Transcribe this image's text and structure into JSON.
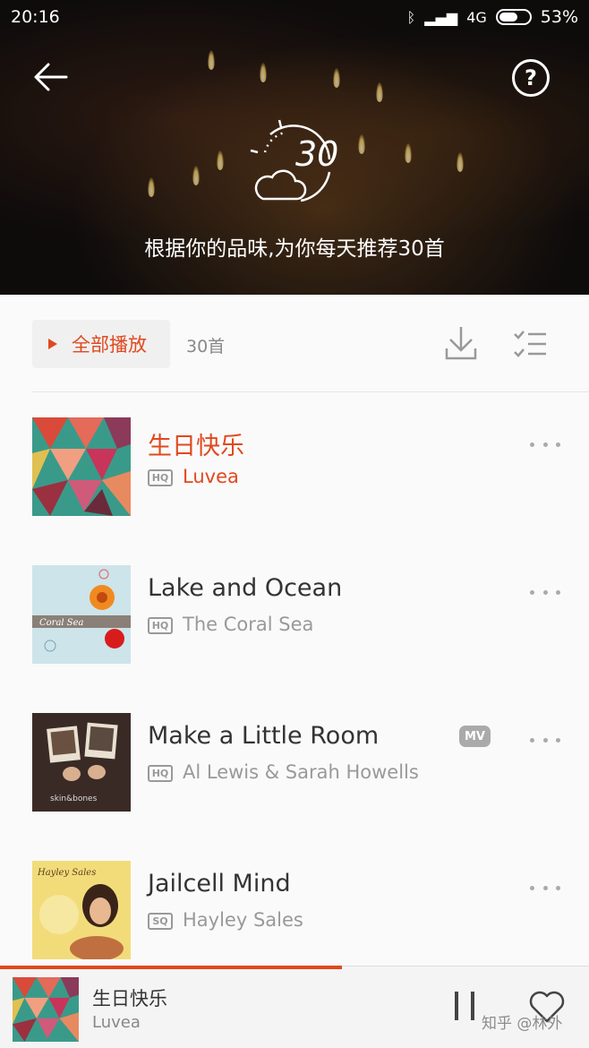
{
  "status_bar": {
    "time": "20:16",
    "network": "4G",
    "battery": "53%"
  },
  "header": {
    "badge_number": "30",
    "caption": "根据你的品味,为你每天推荐30首"
  },
  "actions": {
    "play_all_label": "全部播放",
    "count_label": "30首"
  },
  "songs": [
    {
      "title": "生日快乐",
      "quality": "HQ",
      "artist": "Luvea",
      "active": true,
      "mv": ""
    },
    {
      "title": "Lake and Ocean",
      "quality": "HQ",
      "artist": "The Coral Sea",
      "active": false,
      "mv": ""
    },
    {
      "title": "Make a Little Room",
      "quality": "HQ",
      "artist": "Al Lewis & Sarah Howells",
      "active": false,
      "mv": "MV"
    },
    {
      "title": "Jailcell Mind",
      "quality": "SQ",
      "artist": "Hayley Sales",
      "active": false,
      "mv": ""
    }
  ],
  "covers": {
    "song2_cover_text": "Coral Sea",
    "song3_cover_text": "skin&bones",
    "song4_cover_text": "Hayley Sales"
  },
  "player": {
    "title": "生日快乐",
    "artist": "Luvea",
    "progress": 0.58
  },
  "watermark": "知乎 @林外",
  "colors": {
    "accent": "#e0491e",
    "text_primary": "#333333",
    "text_secondary": "#999999"
  }
}
